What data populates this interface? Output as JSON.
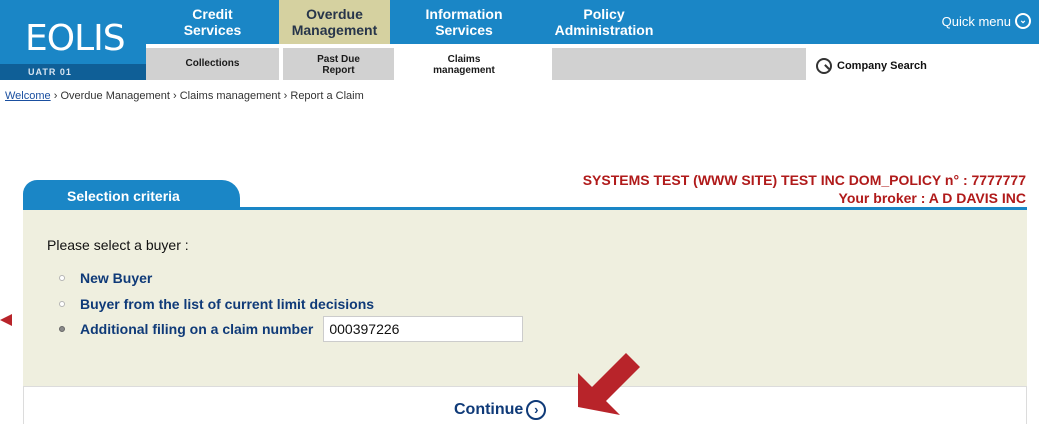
{
  "app": {
    "logo": "EOLIS",
    "environment": "UATR 01"
  },
  "nav": {
    "tabs": [
      {
        "line1": "Credit",
        "line2": "Services"
      },
      {
        "line1": "Overdue",
        "line2": "Management"
      },
      {
        "line1": "Information",
        "line2": "Services"
      },
      {
        "line1": "Policy",
        "line2": "Administration"
      }
    ],
    "quick_menu": "Quick menu"
  },
  "subnav": {
    "tabs": [
      {
        "line1": "Collections",
        "line2": ""
      },
      {
        "line1": "Past Due",
        "line2": "Report"
      },
      {
        "line1": "Claims",
        "line2": "management"
      }
    ],
    "company_search": "Company Search"
  },
  "breadcrumb": {
    "home": "Welcome",
    "sep": "›",
    "items": [
      "Overdue Management",
      "Claims management",
      "Report a Claim"
    ]
  },
  "policy": {
    "line": "SYSTEMS TEST (WWW SITE) TEST INC DOM_POLICY n° : 7777777",
    "broker": "Your broker : A D DAVIS INC"
  },
  "selection": {
    "tab_label": "Selection criteria",
    "prompt": "Please select a buyer :",
    "options": [
      "New Buyer",
      "Buyer from the list of current limit decisions",
      "Additional filing on a claim number"
    ],
    "selected_index": 2,
    "claim_number": "000397226"
  },
  "actions": {
    "continue": "Continue"
  },
  "colors": {
    "nav_blue": "#1a86c6",
    "active_tab": "#d5d1a0",
    "panel_bg": "#efefdf",
    "policy_red": "#b01a1a",
    "annotation_arrow": "#b8242a"
  }
}
